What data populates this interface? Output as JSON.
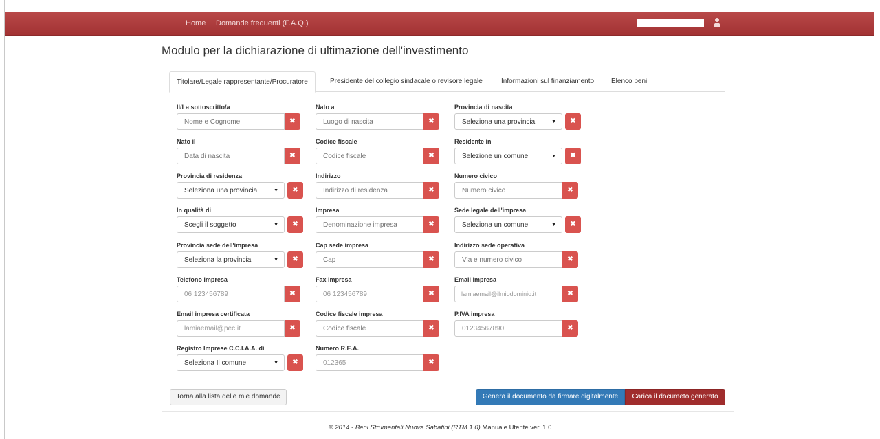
{
  "nav": {
    "home": "Home",
    "faq": "Domande frequenti (F.A.Q.)"
  },
  "page": {
    "title": "Modulo per la dichiarazione di ultimazione dell'investimento"
  },
  "tabs": [
    {
      "label": "Titolare/Legale rappresentante/Procuratore"
    },
    {
      "label": "Presidente del collegio sindacale o revisore legale"
    },
    {
      "label": "Informazioni sul finanziamento"
    },
    {
      "label": "Elenco beni"
    }
  ],
  "fields": {
    "sottoscritto": {
      "label": "Il/La sottoscritto/a",
      "placeholder": "Nome e Cognome"
    },
    "nato_a": {
      "label": "Nato a",
      "placeholder": "Luogo di nascita"
    },
    "provincia_nascita": {
      "label": "Provincia di nascita",
      "value": "Seleziona una provincia"
    },
    "nato_il": {
      "label": "Nato il",
      "placeholder": "Data di nascita"
    },
    "codice_fiscale": {
      "label": "Codice fiscale",
      "placeholder": "Codice fiscale"
    },
    "residente_in": {
      "label": "Residente in",
      "value": "Selezione un comune"
    },
    "provincia_residenza": {
      "label": "Provincia di residenza",
      "value": "Seleziona una provincia"
    },
    "indirizzo": {
      "label": "Indirizzo",
      "placeholder": "Indirizzo di residenza"
    },
    "numero_civico": {
      "label": "Numero civico",
      "placeholder": "Numero civico"
    },
    "in_qualita_di": {
      "label": "In qualità di",
      "value": "Scegli il soggetto"
    },
    "impresa": {
      "label": "Impresa",
      "placeholder": "Denominazione impresa"
    },
    "sede_legale": {
      "label": "Sede legale dell'impresa",
      "value": "Seleziona un comune"
    },
    "provincia_sede": {
      "label": "Provincia sede dell'impresa",
      "value": "Seleziona la provincia"
    },
    "cap_sede": {
      "label": "Cap sede impresa",
      "placeholder": "Cap"
    },
    "indirizzo_sede": {
      "label": "Indirizzo sede operativa",
      "placeholder": "Via e numero civico"
    },
    "telefono": {
      "label": "Telefono impresa",
      "value": "06 123456789"
    },
    "fax": {
      "label": "Fax impresa",
      "value": "06 123456789"
    },
    "email": {
      "label": "Email impresa",
      "value": "lamiaemail@ilmiodominio.it"
    },
    "email_pec": {
      "label": "Email impresa certificata",
      "value": "lamiaemail@pec.it"
    },
    "codice_fiscale_impresa": {
      "label": "Codice fiscale impresa",
      "placeholder": "Codice fiscale"
    },
    "piva": {
      "label": "P.IVA impresa",
      "value": "01234567890"
    },
    "registro_imprese": {
      "label": "Registro Imprese C.C.I.A.A. di",
      "value": "Seleziona Il comune"
    },
    "numero_rea": {
      "label": "Numero R.E.A.",
      "value": "012365"
    }
  },
  "clear_glyph": "✖",
  "caret_glyph": "▼",
  "buttons": {
    "back": "Torna alla lista delle mie domande",
    "generate": "Genera il documento da firmare digitalmente",
    "upload": "Carica il documeto generato"
  },
  "footer": {
    "copyright": "© 2014 - Beni Strumentali Nuova Sabatini (RTM 1.0)",
    "manual": "Manuale Utente ver. 1.0"
  },
  "colors": {
    "navbar": "#a23233",
    "danger": "#d9534f",
    "primary": "#337ab7",
    "upload": "#a02d2d"
  }
}
